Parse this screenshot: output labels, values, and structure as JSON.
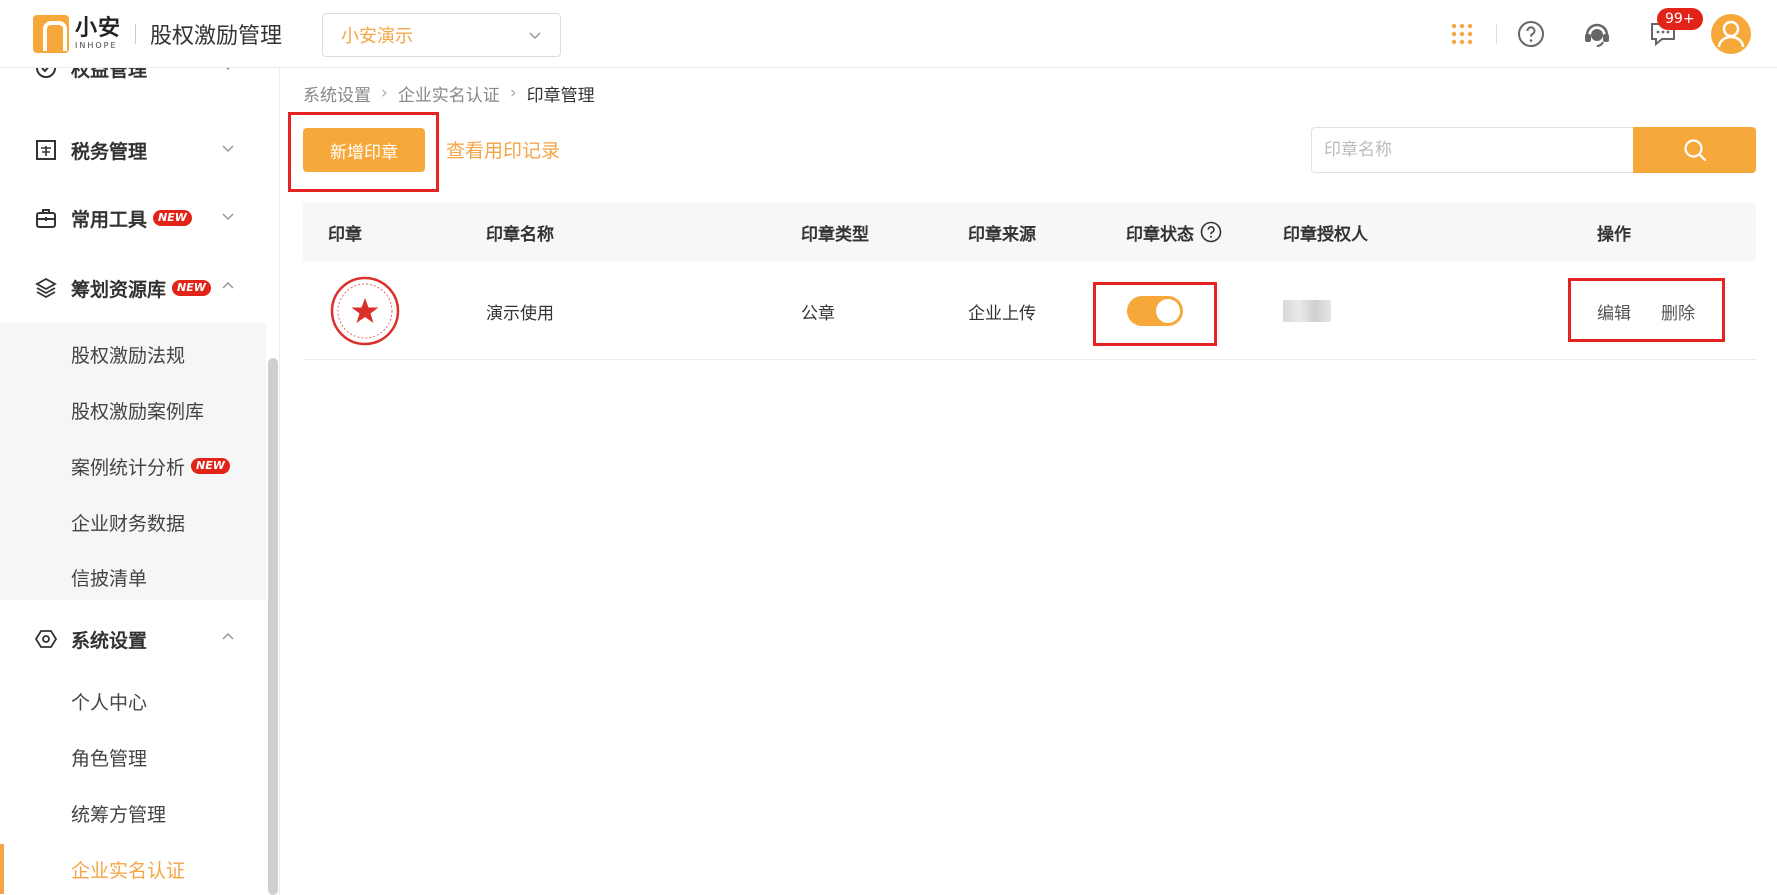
{
  "header": {
    "logo_cn": "小安",
    "logo_en": "INHOPE",
    "app_title": "股权激励管理",
    "org_select": "小安演示",
    "message_badge": "99+",
    "icons": [
      "apps-grid-icon",
      "help-icon",
      "customer-service-icon",
      "message-icon",
      "user-avatar-icon"
    ]
  },
  "sidebar": {
    "groups": [
      {
        "label": "权益管理",
        "icon": "equity-icon",
        "expanded": false,
        "new": false
      },
      {
        "label": "税务管理",
        "icon": "tax-icon",
        "expanded": false,
        "new": false
      },
      {
        "label": "常用工具",
        "icon": "toolbox-icon",
        "expanded": false,
        "new": true
      },
      {
        "label": "筹划资源库",
        "icon": "layers-icon",
        "expanded": true,
        "new": true
      },
      {
        "label": "系统设置",
        "icon": "settings-icon",
        "expanded": true,
        "new": false
      }
    ],
    "resource_items": [
      {
        "label": "股权激励法规",
        "new": false
      },
      {
        "label": "股权激励案例库",
        "new": false
      },
      {
        "label": "案例统计分析",
        "new": true
      },
      {
        "label": "企业财务数据",
        "new": false
      },
      {
        "label": "信披清单",
        "new": false
      }
    ],
    "settings_items": [
      {
        "label": "个人中心"
      },
      {
        "label": "角色管理"
      },
      {
        "label": "统筹方管理"
      },
      {
        "label": "企业实名认证",
        "active": true
      }
    ],
    "new_tag": "NEW"
  },
  "breadcrumb": [
    "系统设置",
    "企业实名认证",
    "印章管理"
  ],
  "toolbar": {
    "add_button": "新增印章",
    "records_link": "查看用印记录",
    "search_placeholder": "印章名称"
  },
  "table": {
    "headers": [
      "印章",
      "印章名称",
      "印章类型",
      "印章来源",
      "印章状态",
      "印章授权人",
      "操作"
    ],
    "rows": [
      {
        "seal": "seal-image",
        "name": "演示使用",
        "type": "公章",
        "source": "企业上传",
        "status_on": true,
        "authorized": "",
        "actions": [
          "编辑",
          "删除"
        ]
      }
    ]
  },
  "colors": {
    "accent": "#f7a83b",
    "accent_text": "#f5a545",
    "badge": "#e2231a",
    "highlight": "#e62222"
  }
}
